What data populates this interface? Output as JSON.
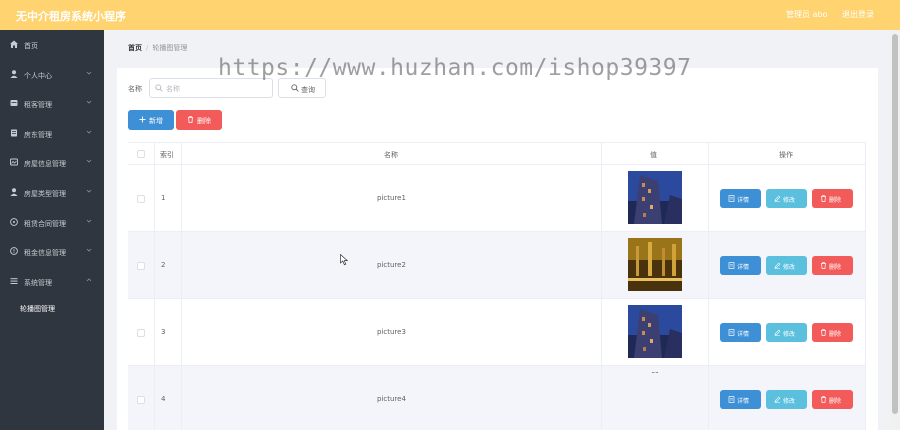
{
  "app": {
    "title": "无中介租房系统小程序",
    "admin_label": "管理员 abo",
    "logout_label": "退出登录"
  },
  "sidebar": {
    "items": [
      {
        "label": "首页",
        "icon": "home-icon"
      },
      {
        "label": "个人中心",
        "icon": "user-icon"
      },
      {
        "label": "租客管理",
        "icon": "tenant-icon"
      },
      {
        "label": "房东管理",
        "icon": "landlord-icon"
      },
      {
        "label": "房屋信息管理",
        "icon": "house-info-icon"
      },
      {
        "label": "房屋类型管理",
        "icon": "house-type-icon"
      },
      {
        "label": "租赁合同管理",
        "icon": "contract-icon"
      },
      {
        "label": "租金信息管理",
        "icon": "rent-icon"
      },
      {
        "label": "系统管理",
        "icon": "system-icon"
      }
    ],
    "sub_item": "轮播图管理"
  },
  "breadcrumb": {
    "home": "首页",
    "separator": "/",
    "current": "轮播图管理"
  },
  "search": {
    "label": "名称",
    "placeholder": "名称",
    "query_label": "查询"
  },
  "actions": {
    "add_label": "新增",
    "delete_label": "删除"
  },
  "table": {
    "columns": [
      "索引",
      "名称",
      "值",
      "操作"
    ],
    "rows": [
      {
        "index": "1",
        "name": "picture1"
      },
      {
        "index": "2",
        "name": "picture2"
      },
      {
        "index": "3",
        "name": "picture3"
      },
      {
        "index": "4",
        "name": "picture4"
      }
    ],
    "op_labels": {
      "detail": "详情",
      "edit": "修改",
      "remove": "删除"
    }
  },
  "watermark": "https://www.huzhan.com/ishop39397",
  "colors": {
    "topbar": "#ffd36f",
    "sidebar": "#30363f",
    "primary": "#3d8fd6",
    "danger": "#f35b5b",
    "info": "#5bc0de"
  }
}
